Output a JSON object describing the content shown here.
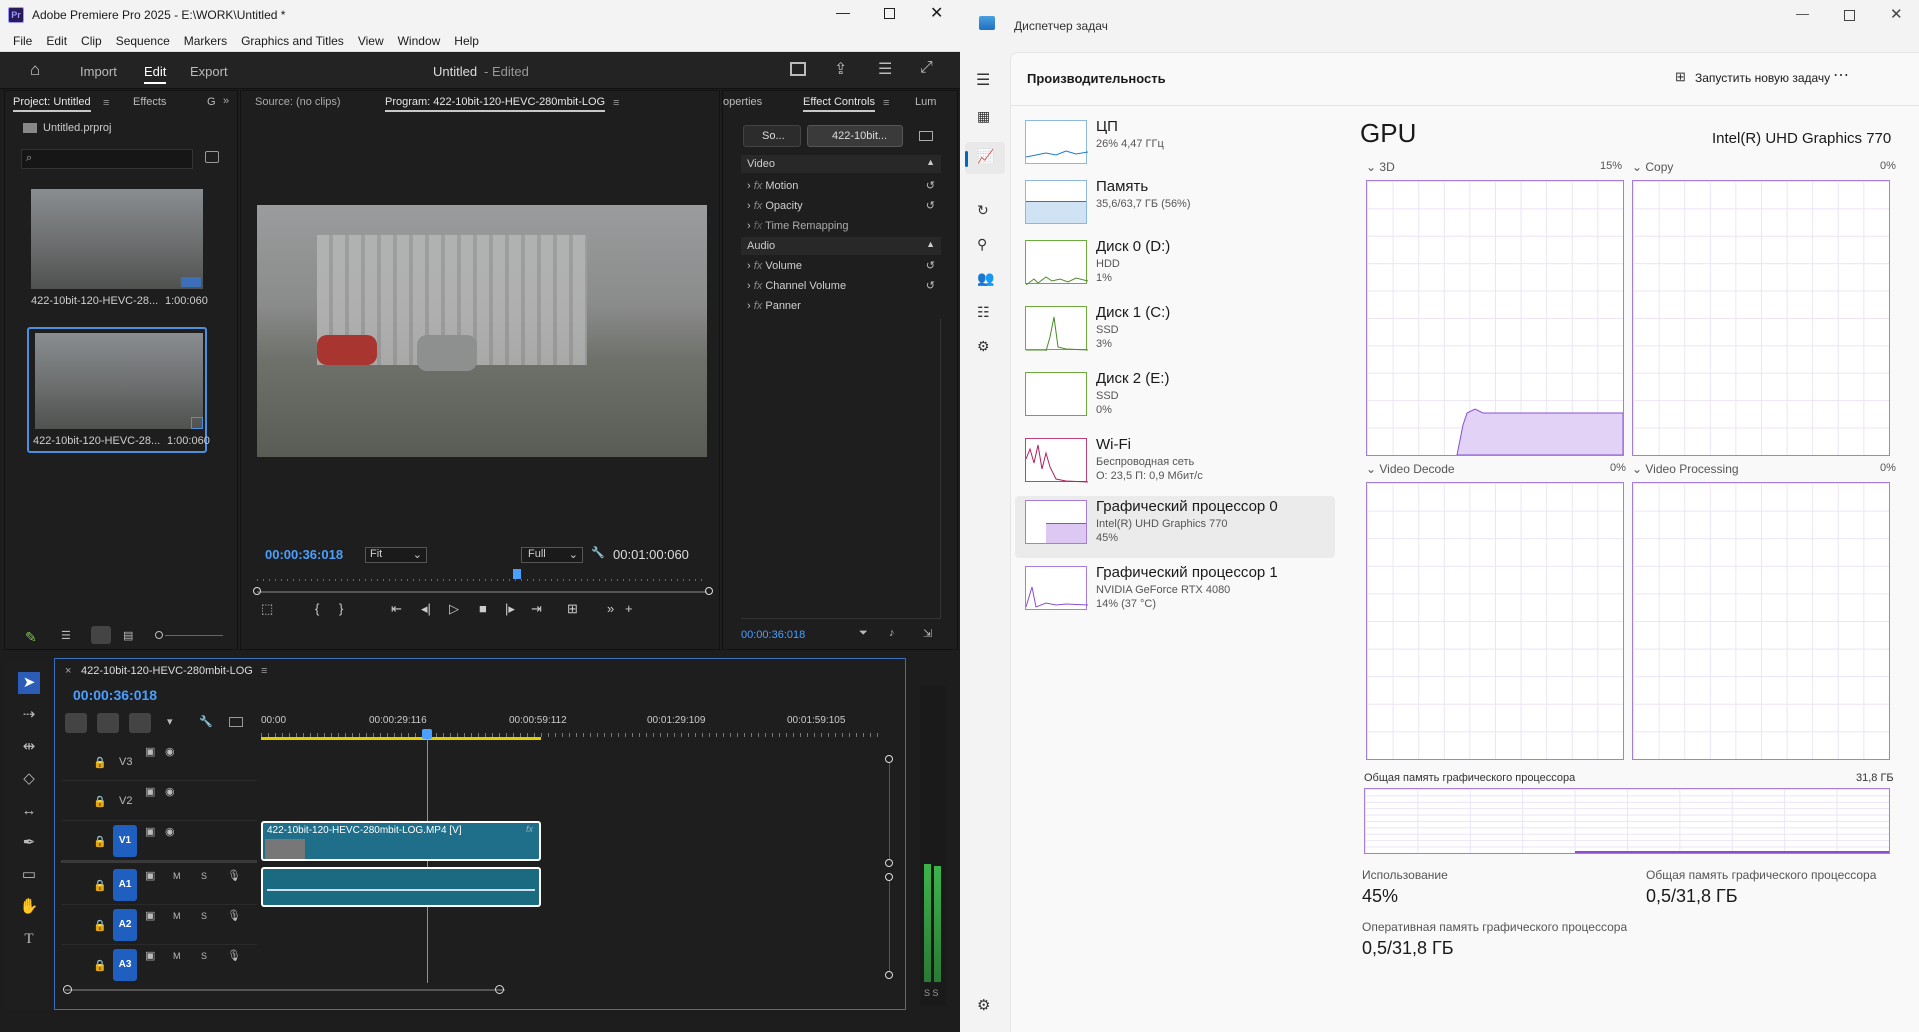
{
  "premiere": {
    "title": "Adobe Premiere Pro 2025 - E:\\WORK\\Untitled *",
    "menu": [
      "File",
      "Edit",
      "Clip",
      "Sequence",
      "Markers",
      "Graphics and Titles",
      "View",
      "Window",
      "Help"
    ],
    "header": {
      "import": "Import",
      "edit": "Edit",
      "export": "Export",
      "doc_title": "Untitled",
      "doc_status": "- Edited"
    },
    "project": {
      "tab_project": "Project: Untitled",
      "tab_effects": "Effects",
      "tab_trunc": "G",
      "file": "Untitled.prproj",
      "clips": [
        {
          "name": "422-10bit-120-HEVC-28...",
          "dur": "1:00:060"
        },
        {
          "name": "422-10bit-120-HEVC-28...",
          "dur": "1:00:060"
        }
      ]
    },
    "monitor": {
      "source_tab": "Source: (no clips)",
      "program_tab": "Program: 422-10bit-120-HEVC-280mbit-LOG",
      "timecode": "00:00:36:018",
      "fit": "Fit",
      "quality": "Full",
      "duration": "00:01:00:060"
    },
    "effects": {
      "tab_props": "operties",
      "tab_ec": "Effect Controls",
      "tab_lum": "Lum",
      "src_btn": "So...",
      "clip_btn": "422-10bit...",
      "video": "Video",
      "audio": "Audio",
      "video_fx": [
        "Motion",
        "Opacity",
        "Time Remapping"
      ],
      "audio_fx": [
        "Volume",
        "Channel Volume",
        "Panner"
      ],
      "timecode": "00:00:36:018"
    },
    "timeline": {
      "seq_name": "422-10bit-120-HEVC-280mbit-LOG",
      "timecode": "00:00:36:018",
      "ruler": [
        "00:00",
        "00:00:29:116",
        "00:00:59:112",
        "00:01:29:109",
        "00:01:59:105"
      ],
      "tracks": [
        "V3",
        "V2",
        "V1",
        "A1",
        "A2",
        "A3"
      ],
      "video_clip": "422-10bit-120-HEVC-280mbit-LOG.MP4 [V]",
      "m": "M",
      "s": "S",
      "meter": "S S"
    }
  },
  "taskmanager": {
    "title": "Диспетчер задач",
    "page": "Производительность",
    "new_task": "Запустить новую задачу",
    "devices": [
      {
        "name": "ЦП",
        "l1": "26% 4,47 ГГц",
        "l2": "",
        "l3": ""
      },
      {
        "name": "Память",
        "l1": "35,6/63,7 ГБ (56%)",
        "l2": "",
        "l3": ""
      },
      {
        "name": "Диск 0 (D:)",
        "l1": "HDD",
        "l2": "1%",
        "l3": ""
      },
      {
        "name": "Диск 1 (C:)",
        "l1": "SSD",
        "l2": "3%",
        "l3": ""
      },
      {
        "name": "Диск 2 (E:)",
        "l1": "SSD",
        "l2": "0%",
        "l3": ""
      },
      {
        "name": "Wi-Fi",
        "l1": "Беспроводная сеть",
        "l2": "О: 23,5 П: 0,9 Мбит/с",
        "l3": ""
      },
      {
        "name": "Графический процессор 0",
        "l1": "Intel(R) UHD Graphics 770",
        "l2": "45%",
        "l3": ""
      },
      {
        "name": "Графический процессор 1",
        "l1": "NVIDIA GeForce RTX 4080",
        "l2": "14% (37 °C)",
        "l3": ""
      }
    ],
    "gpu": {
      "title": "GPU",
      "model": "Intel(R) UHD Graphics 770",
      "engines": [
        {
          "name": "3D",
          "pct": "15%"
        },
        {
          "name": "Copy",
          "pct": "0%"
        },
        {
          "name": "Video Decode",
          "pct": "0%"
        },
        {
          "name": "Video Processing",
          "pct": "0%"
        }
      ],
      "shared_label": "Общая память графического процессора",
      "shared_max": "31,8 ГБ",
      "usage_label": "Использование",
      "usage": "45%",
      "shared_mem_label": "Общая память графического процессора",
      "shared_mem": "0,5/31,8 ГБ",
      "dedicated_label": "Оперативная память графического процессора",
      "dedicated": "0,5/31,8 ГБ"
    }
  }
}
